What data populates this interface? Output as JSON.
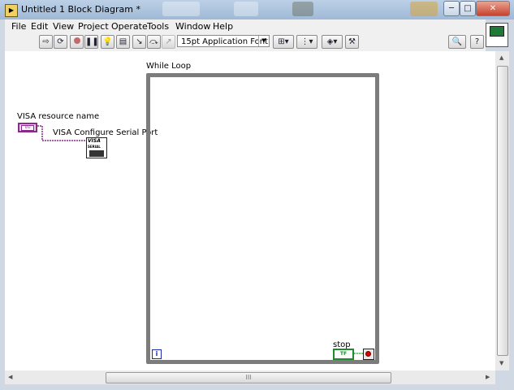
{
  "window": {
    "title": "Untitled 1 Block Diagram *"
  },
  "window_buttons": {
    "minimize": "─",
    "maximize": "□",
    "close": "✕"
  },
  "menu": [
    "File",
    "Edit",
    "View",
    "Project",
    "Operate",
    "Tools",
    "Window",
    "Help"
  ],
  "toolbar": {
    "font_label": "15pt Application Font",
    "buttons": [
      "run-arrow",
      "run-continuously",
      "abort",
      "pause",
      "highlight-execution",
      "retain-wire-values",
      "step-into",
      "step-over",
      "step-out",
      "align",
      "distribute",
      "reorder",
      "search",
      "help"
    ]
  },
  "diagram": {
    "visa_resource_label": "VISA resource name",
    "visa_resource_value": "I/O",
    "visa_configure_label": "VISA Configure Serial Port",
    "visa_node_text": "VISA",
    "visa_node_subtext": "SERIAL",
    "while_loop_label": "While Loop",
    "iteration_terminal": "i",
    "stop_label": "stop",
    "stop_terminal_text": "TF",
    "wire_color": "#8a2a8a"
  },
  "scroll": {
    "h_thumb_grip": "III"
  }
}
